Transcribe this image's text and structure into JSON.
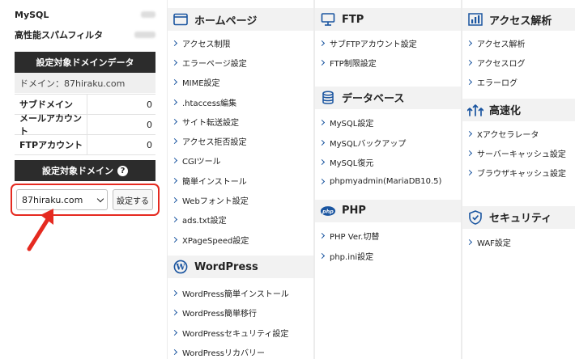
{
  "sidebar": {
    "stats": [
      {
        "label": "MySQL"
      },
      {
        "label": "高性能スパムフィルタ"
      }
    ],
    "domain_data_header": "設定対象ドメインデータ",
    "domain_line": "ドメイン：87hiraku.com",
    "counts": [
      {
        "label": "サブドメイン",
        "value": "0"
      },
      {
        "label": "メールアカウント",
        "value": "0"
      },
      {
        "label": "FTPアカウント",
        "value": "0"
      }
    ],
    "target_domain_header": "設定対象ドメイン",
    "help_icon": "?",
    "domain_select_value": "87hiraku.com",
    "set_button": "設定する"
  },
  "sections": {
    "homepage": {
      "title": "ホームページ",
      "icon": "window-icon",
      "items": [
        "アクセス制限",
        "エラーページ設定",
        "MIME設定",
        ".htaccess編集",
        "サイト転送設定",
        "アクセス拒否設定",
        "CGIツール",
        "簡単インストール",
        "Webフォント設定",
        "ads.txt設定",
        "XPageSpeed設定"
      ]
    },
    "wordpress": {
      "title": "WordPress",
      "icon": "wordpress-icon",
      "items": [
        "WordPress簡単インストール",
        "WordPress簡単移行",
        "WordPressセキュリティ設定",
        "WordPressリカバリー"
      ]
    },
    "ftp": {
      "title": "FTP",
      "icon": "monitor-icon",
      "items": [
        "サブFTPアカウント設定",
        "FTP制限設定"
      ]
    },
    "database": {
      "title": "データベース",
      "icon": "database-icon",
      "items": [
        "MySQL設定",
        "MySQLバックアップ",
        "MySQL復元",
        "phpmyadmin(MariaDB10.5)"
      ]
    },
    "php": {
      "title": "PHP",
      "icon": "php-icon",
      "items": [
        "PHP Ver.切替",
        "php.ini設定"
      ]
    },
    "access": {
      "title": "アクセス解析",
      "icon": "bar-chart-icon",
      "items": [
        "アクセス解析",
        "アクセスログ",
        "エラーログ"
      ]
    },
    "speed": {
      "title": "高速化",
      "icon": "speed-icon",
      "items": [
        "Xアクセラレータ",
        "サーバーキャッシュ設定",
        "ブラウザキャッシュ設定"
      ]
    },
    "security": {
      "title": "セキュリティ",
      "icon": "shield-icon",
      "items": [
        "WAF設定"
      ]
    }
  },
  "colors": {
    "accent": "#1a55a0",
    "highlight": "#e52a20",
    "header_dark": "#2c2c2c"
  }
}
